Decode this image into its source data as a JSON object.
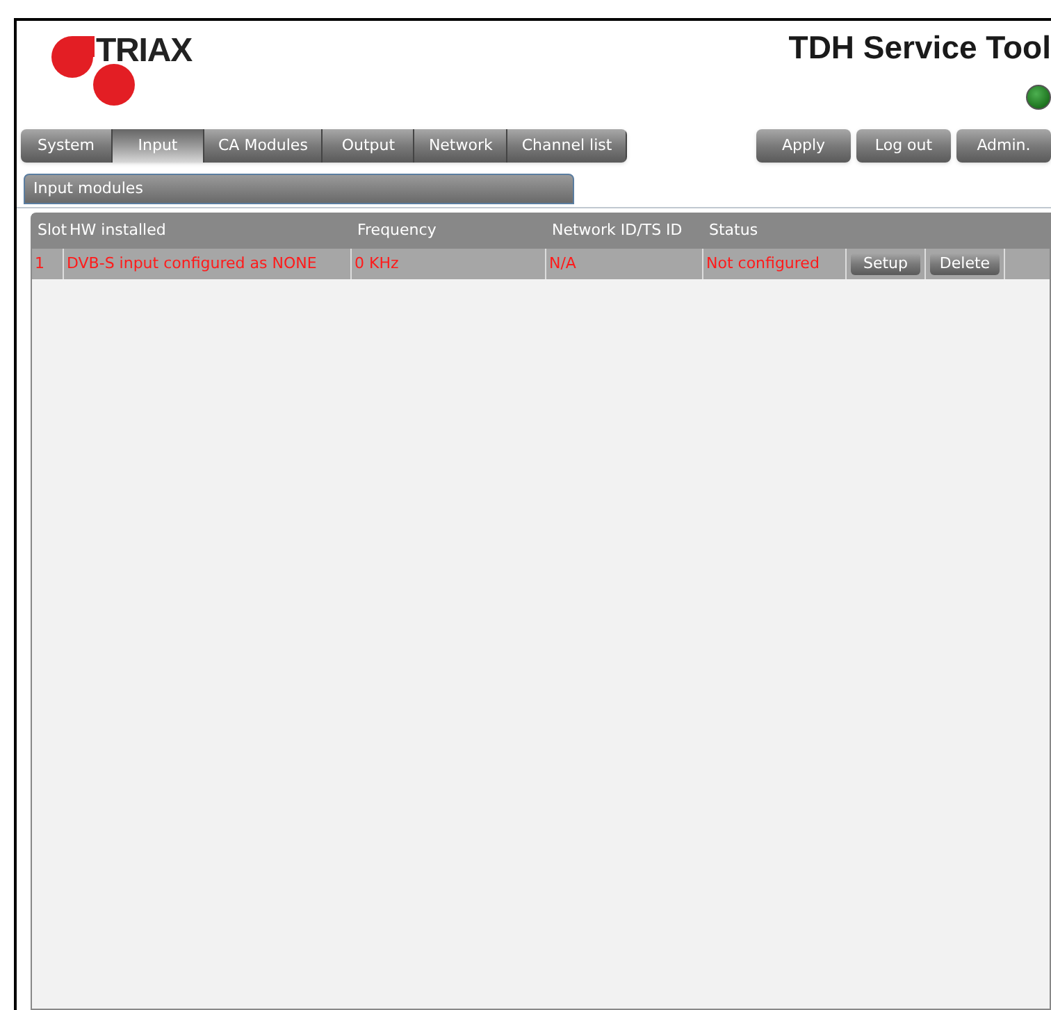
{
  "logo": {
    "text": "TRIAX"
  },
  "title": "TDH Service Tool",
  "status_led": {
    "online": true
  },
  "tabs": [
    {
      "label": "System",
      "selected": false
    },
    {
      "label": "Input",
      "selected": true
    },
    {
      "label": "CA Modules",
      "selected": false
    },
    {
      "label": "Output",
      "selected": false
    },
    {
      "label": "Network",
      "selected": false
    },
    {
      "label": "Channel list",
      "selected": false
    }
  ],
  "actions": [
    "Apply",
    "Log out",
    "Admin."
  ],
  "panel": {
    "title": "Input modules"
  },
  "table": {
    "columns": [
      "Slot",
      "HW installed",
      "Frequency",
      "Network ID/TS ID",
      "Status"
    ],
    "rows": [
      {
        "cells": [
          "1",
          "DVB-S input configured as NONE",
          "0 KHz",
          "N/A",
          "Not configured"
        ],
        "configured": false,
        "buttons": [
          "Setup",
          "Delete"
        ]
      }
    ]
  }
}
